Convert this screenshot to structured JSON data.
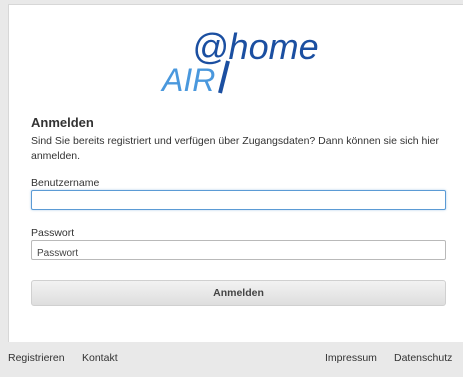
{
  "brand": {
    "logo_text_home": "@home",
    "logo_text_air": "AIR",
    "color_dark_blue": "#1b4fa1",
    "color_light_blue": "#4a98dd"
  },
  "login": {
    "heading": "Anmelden",
    "intro": "Sind Sie bereits registriert und verfügen über Zugangsdaten? Dann können sie sich hier anmelden.",
    "username_label": "Benutzername",
    "username_value": "",
    "password_label": "Passwort",
    "password_placeholder": "Passwort",
    "submit_label": "Anmelden"
  },
  "footer": {
    "links": [
      "Registrieren",
      "Kontakt",
      "Impressum",
      "Datenschutz"
    ]
  }
}
